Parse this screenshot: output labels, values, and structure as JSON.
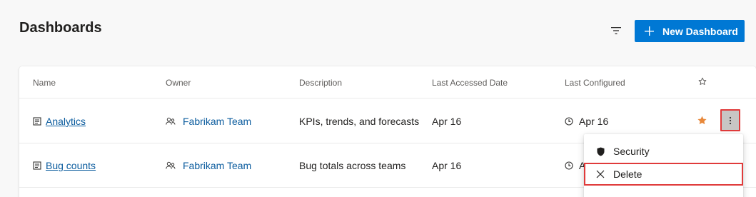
{
  "header": {
    "title": "Dashboards",
    "new_button_label": "New Dashboard"
  },
  "table": {
    "columns": [
      "Name",
      "Owner",
      "Description",
      "Last Accessed Date",
      "Last Configured"
    ],
    "rows": [
      {
        "name": "Analytics",
        "owner": "Fabrikam Team",
        "description": "KPIs, trends, and forecasts",
        "last_accessed": "Apr 16",
        "last_configured": "Apr 16",
        "favorited": true
      },
      {
        "name": "Bug counts",
        "owner": "Fabrikam Team",
        "description": "Bug totals across teams",
        "last_accessed": "Apr 16",
        "last_configured": "A",
        "favorited": false
      }
    ]
  },
  "context_menu": {
    "items": [
      {
        "label": "Security",
        "icon": "shield-icon"
      },
      {
        "label": "Delete",
        "icon": "close-icon"
      }
    ]
  },
  "colors": {
    "accent": "#0078d4",
    "link": "#0b5c9e",
    "favorite_star": "#e8883a",
    "highlight": "#e03b3b"
  }
}
